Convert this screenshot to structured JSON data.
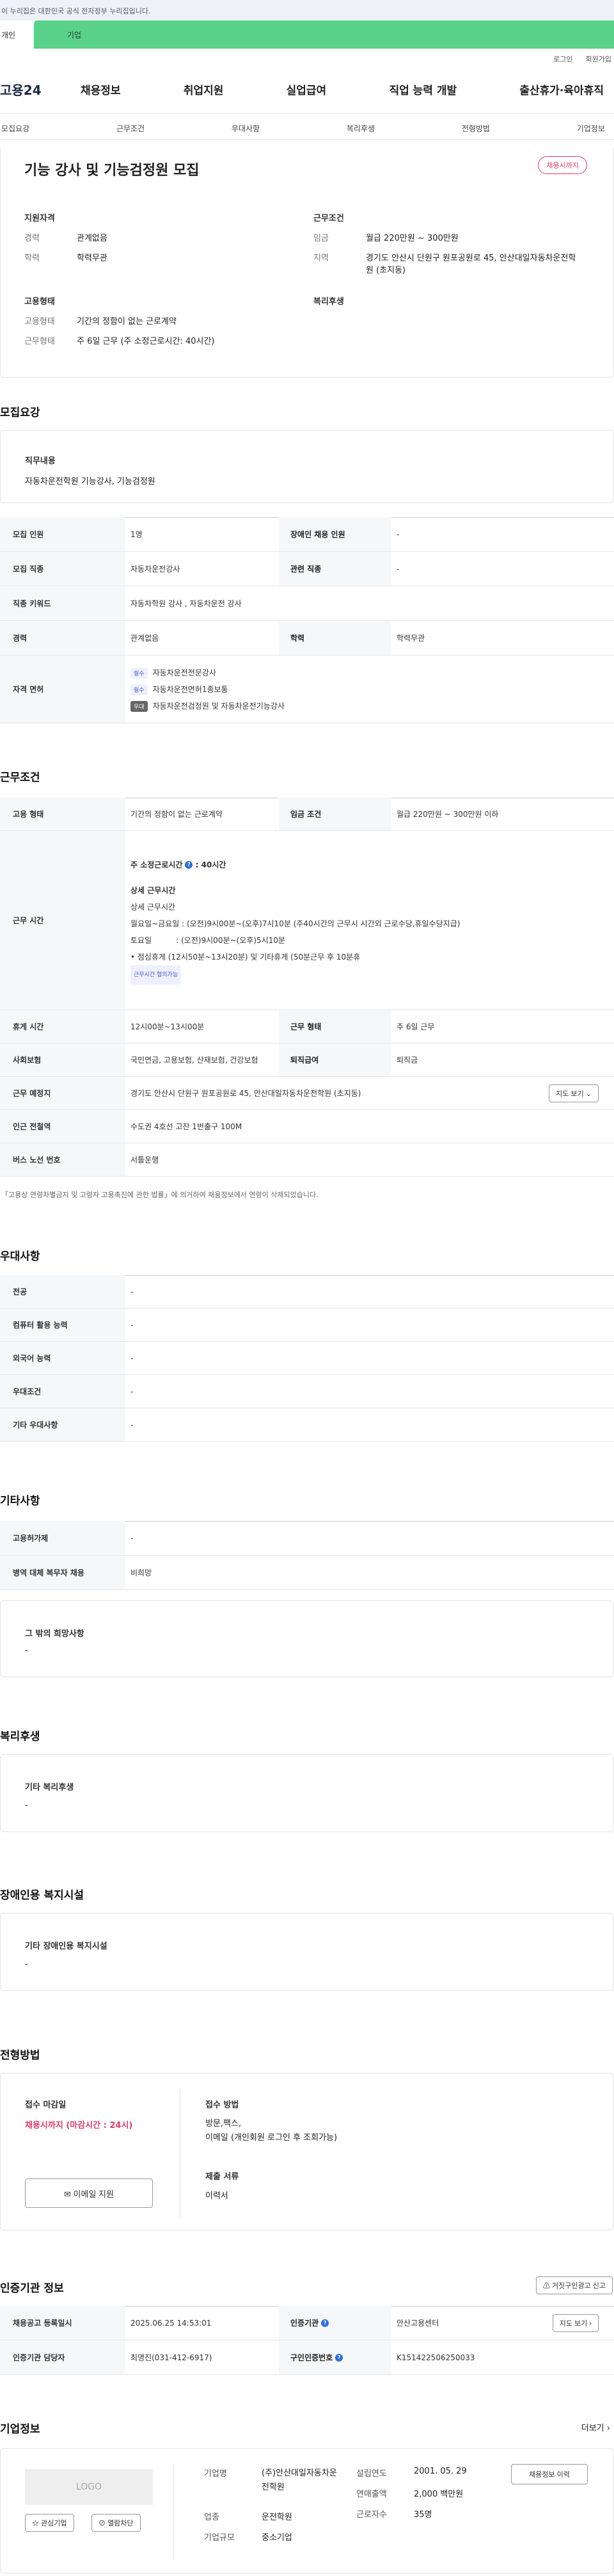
{
  "gov_banner": "이 누리집은 대한민국 공식 전자정부 누리집입니다.",
  "top_tabs": [
    "개인",
    "기업"
  ],
  "util": [
    "로그인",
    "회원가입"
  ],
  "logo": "고용24",
  "gnb": [
    "채용정보",
    "취업지원",
    "실업급여",
    "직업 능력 개발",
    "출산휴가·육아휴직"
  ],
  "snb": [
    "모집요강",
    "근무조건",
    "우대사항",
    "복리후생",
    "전형방법",
    "기업정보"
  ],
  "job": {
    "title": "기능 강사 및 기능검정원 모집",
    "status": "채용시까지",
    "req_head": "지원자격",
    "cond_head": "근무조건",
    "emp_head": "고용형태",
    "welfare_head": "복리후생",
    "career_k": "경력",
    "career_v": "관계없음",
    "edu_k": "학력",
    "edu_v": "학력무관",
    "wage_k": "임금",
    "wage_v": "월급 220만원 ~ 300만원",
    "loc_k": "지역",
    "loc_v": "경기도 안산시 단원구 원포공원로 45, 안산대일자동차운전학원 (초지동)",
    "emptype_k": "고용형태",
    "emptype_v": "기간의 정함이 없는 근로계약",
    "worktime_k": "근무형태",
    "worktime_v": "주 6일 근무 (주 소정근로시간: 40시간)"
  },
  "sec": {
    "recruit": "모집요강",
    "cond": "근무조건",
    "pref": "우대사항",
    "etc": "기타사항",
    "welfare": "복리후생",
    "disab": "장애인용 복지시설",
    "process": "전형방법",
    "cert": "인증기관 정보",
    "company": "기업정보"
  },
  "duty": {
    "label": "직무내용",
    "value": "자동차운전학원 기능강사, 기능검정원"
  },
  "recruit": {
    "count_k": "모집 인원",
    "count_v": "1명",
    "disab_k": "장애인 채용 인원",
    "disab_v": "-",
    "job_k": "모집 직종",
    "job_v": "자동차운전강사",
    "rel_k": "관련 직종",
    "rel_v": "-",
    "kw_k": "직종 키워드",
    "kw_v": "자동차학원 강사 , 자동차운전 강사",
    "career_k": "경력",
    "career_v": "관계없음",
    "edu_k": "학력",
    "edu_v": "학력무관",
    "lic_k": "자격 면허",
    "tag_req": "필수",
    "tag_pref": "우대",
    "lic1": "자동차운전전문강사",
    "lic2": "자동차운전면허1종보통",
    "lic3": "자동차운전검정원 및 자동차운전기능강사"
  },
  "cond": {
    "emp_k": "고용 형태",
    "emp_v": "기간의 정함이 없는 근로계약",
    "wage_k": "임금 조건",
    "wage_v": "월급 220만원 ~ 300만원 이하",
    "time_k": "근무 시간",
    "hours_lbl": "주 소정근로시간",
    "hours_v": ": 40시간",
    "detail_h": "상세 근무시간",
    "detail_sub": "상세 근무시간",
    "line1": "월요일~금요일 : (오전)9시00분~(오후)7시10분 (주40시간의 근무시 시간외 근로수당,휴일수당지급)",
    "line2": "토요일          : (오전)9시00분~(오후)5시10분",
    "line3": "• 점심휴게 (12시50분~13시20분) 및 기타휴게 (50분근무 후 10분휴",
    "tag": "근무시간 협의가능",
    "rest_k": "휴게 시간",
    "rest_v": "12시00분~13시00분",
    "form_k": "근무 형태",
    "form_v": "주 6일 근무",
    "ins_k": "사회보험",
    "ins_v": "국민연금, 고용보험, 산재보험, 건강보험",
    "sev_k": "퇴직급여",
    "sev_v": "퇴직금",
    "place_k": "근무 예정지",
    "place_v": "경기도 안산시 단원구 원포공원로 45, 안산대일자동차운전학원 (초지동)",
    "map_btn": "지도 보기",
    "sub_k": "인근 전철역",
    "sub_v": "수도권 4호선 고잔 1번출구 100M",
    "bus_k": "버스 노선 번호",
    "bus_v": "서틀운행",
    "note": "「고용상 연령차별금지 및 고령자 고용촉진에 관한 법률」에 의거하여 채용정보에서 연령이 삭제되었습니다."
  },
  "pref": [
    {
      "k": "전공",
      "v": "-"
    },
    {
      "k": "컴퓨터 활용 능력",
      "v": "-"
    },
    {
      "k": "외국어 능력",
      "v": "-"
    },
    {
      "k": "우대조건",
      "v": "-"
    },
    {
      "k": "기타 우대사항",
      "v": "-"
    }
  ],
  "etc": [
    {
      "k": "고용허가제",
      "v": "-"
    },
    {
      "k": "병역 대체 복무자 채용",
      "v": "비희망"
    }
  ],
  "etc_box": {
    "label": "그 밖의 희망사항",
    "value": "-"
  },
  "welfare": {
    "label": "기타 복리후생",
    "value": "-"
  },
  "disab": {
    "label": "기타 장애인용 복지시설",
    "value": "-"
  },
  "process": {
    "deadline_k": "접수 마감일",
    "deadline_v": "채용시까지 (마감시간 : 24시)",
    "email_btn": "이메일 지원",
    "method_k": "접수 방법",
    "method_v1": "방문,팩스,",
    "method_v2": "이메일 (개인회원 로그인 후 조회가능)",
    "docs_k": "제출 서류",
    "docs_v": "이력서"
  },
  "cert": {
    "report_btn": "거짓구인광고 신고",
    "reg_k": "채용공고 등록일시",
    "reg_v": "2025.06.25 14:53:01",
    "org_k": "인증기관",
    "org_v": "안산고용센터",
    "map_btn": "지도 보기",
    "mgr_k": "인증기관 담당자",
    "mgr_v": "최명진(031-412-6917)",
    "num_k": "구인인증번호",
    "num_v": "K151422506250033"
  },
  "company": {
    "more": "더보기",
    "logo": "LOGO",
    "fav": "관심기업",
    "block": "열람차단",
    "name_k": "기업명",
    "name_v": "(주)안산대일자동차운전학원",
    "ind_k": "업종",
    "ind_v": "운전학원",
    "size_k": "기업규모",
    "size_v": "중소기업",
    "year_k": "설립연도",
    "year_v": "2001. 05. 29",
    "rev_k": "연매출액",
    "rev_v": "2,000 백만원",
    "emp_k": "근로자수",
    "emp_v": "35명",
    "hist_btn": "채용정보 이력"
  },
  "colors": {
    "accent_green": "#5bd28a",
    "status_red": "#e23a6b"
  }
}
